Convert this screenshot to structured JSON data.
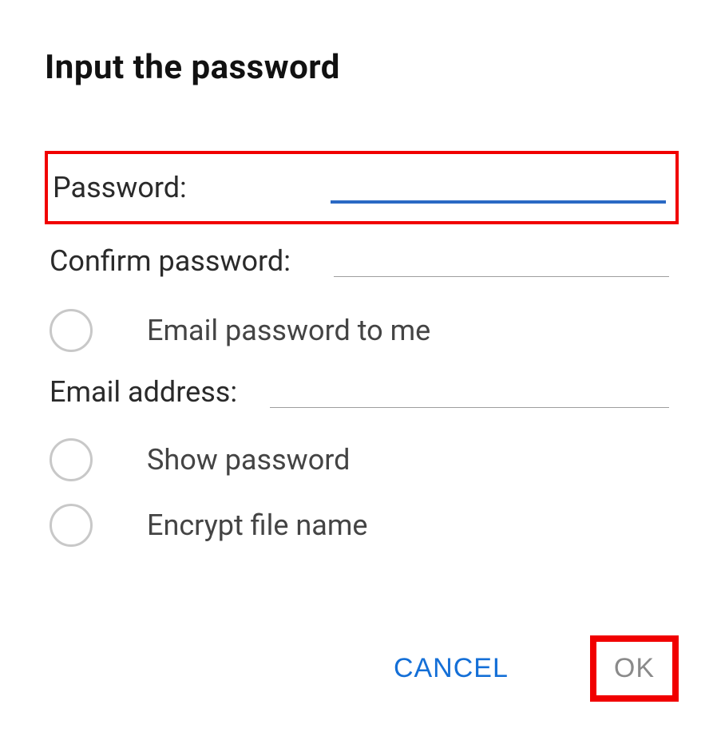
{
  "dialog": {
    "title": "Input the password",
    "password_label": "Password:",
    "confirm_label": "Confirm password:",
    "email_option_label": "Email password to me",
    "email_address_label": "Email address:",
    "show_password_label": "Show password",
    "encrypt_file_label": "Encrypt file name",
    "cancel_label": "CANCEL",
    "ok_label": "OK",
    "password_value": "",
    "confirm_value": "",
    "email_value": ""
  }
}
